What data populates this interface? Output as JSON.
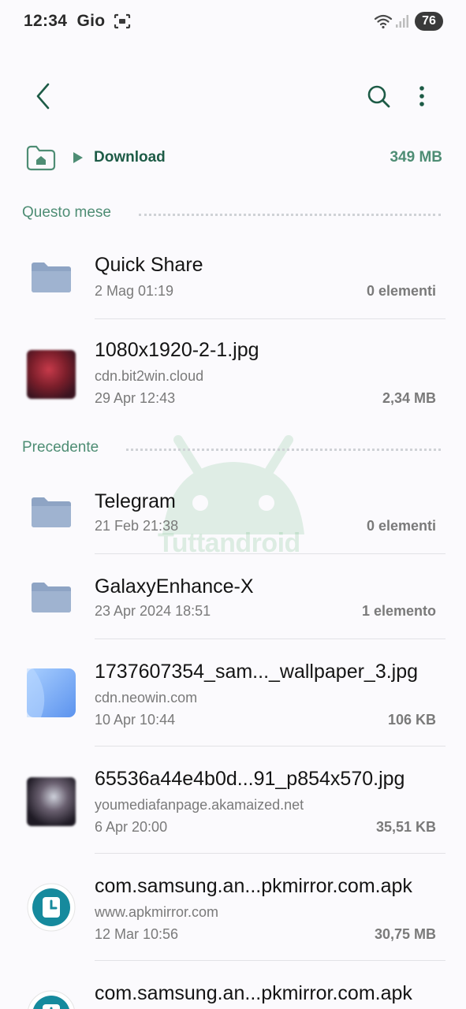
{
  "status_bar": {
    "time": "12:34",
    "day": "Gio",
    "battery": "76"
  },
  "toolbar": {
    "back_icon": "chevron-left-icon",
    "search_icon": "search-icon",
    "more_icon": "more-vertical-icon"
  },
  "breadcrumb": {
    "current": "Download",
    "size": "349 MB"
  },
  "watermark": "Tuttandroid",
  "sections": [
    {
      "title": "Questo mese",
      "items": [
        {
          "name": "Quick Share",
          "source": "",
          "date": "2 Mag 01:19",
          "size": "0 elementi",
          "icon": "folder-icon"
        },
        {
          "name": "1080x1920-2-1.jpg",
          "source": "cdn.bit2win.cloud",
          "date": "29 Apr 12:43",
          "size": "2,34 MB",
          "icon": "image-thumbnail"
        }
      ]
    },
    {
      "title": "Precedente",
      "items": [
        {
          "name": "Telegram",
          "source": "",
          "date": "21 Feb 21:38",
          "size": "0 elementi",
          "icon": "folder-icon"
        },
        {
          "name": "GalaxyEnhance-X",
          "source": "",
          "date": "23 Apr 2024 18:51",
          "size": "1 elemento",
          "icon": "folder-icon"
        },
        {
          "name": "1737607354_sam..._wallpaper_3.jpg",
          "source": "cdn.neowin.com",
          "date": "10 Apr 10:44",
          "size": "106 KB",
          "icon": "image-thumbnail"
        },
        {
          "name": "65536a44e4b0d...91_p854x570.jpg",
          "source": "youmediafanpage.akamaized.net",
          "date": "6 Apr 20:00",
          "size": "35,51 KB",
          "icon": "image-thumbnail"
        },
        {
          "name": "com.samsung.an...pkmirror.com.apk",
          "source": "www.apkmirror.com",
          "date": "12 Mar 10:56",
          "size": "30,75 MB",
          "icon": "clock-app-icon"
        },
        {
          "name": "com.samsung.an...pkmirror.com.apk",
          "source": "",
          "date": "",
          "size": "",
          "icon": "clock-app-icon"
        }
      ]
    }
  ],
  "colors": {
    "accent": "#1d5b46",
    "accent_light": "#4e8d74",
    "folder": "#8ea4c4",
    "apk_teal": "#168a9d"
  }
}
